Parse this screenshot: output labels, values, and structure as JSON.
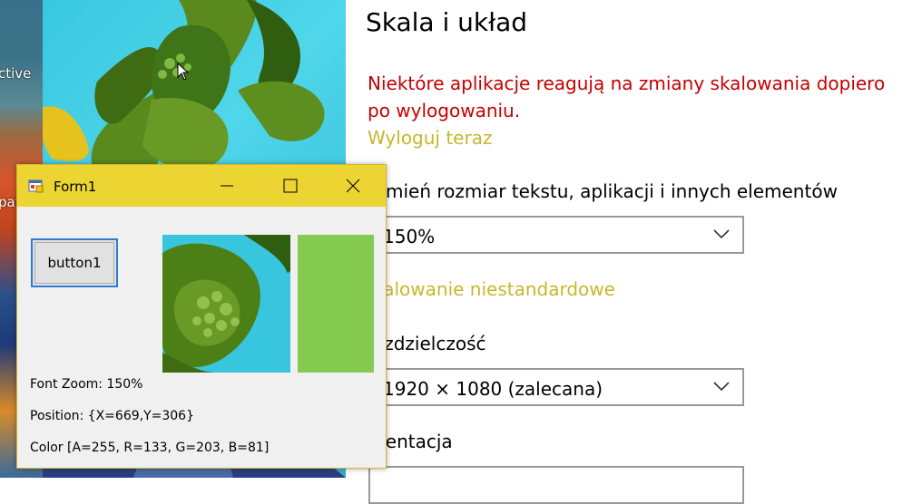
{
  "desktop": {
    "left_texts": [
      "ctive",
      "pat"
    ]
  },
  "settings": {
    "title": "Skala i układ",
    "warning": "Niektóre aplikacje reagują na zmiany skalowania dopiero po wylogowaniu.",
    "logout_link": "Wyloguj teraz",
    "size_label": "mień rozmiar tekstu, aplikacji i innych elementów",
    "scale_value": "150%",
    "custom_scaling_link": "kalowanie niestandardowe",
    "resolution_label": "ozdzielczość",
    "resolution_value": "1920 × 1080 (zalecana)",
    "orientation_label": "rientacja",
    "accent_link_color": "#c7b72c",
    "warning_color": "#c50000"
  },
  "form1": {
    "title": "Form1",
    "button_label": "button1",
    "font_zoom": "Font Zoom: 150%",
    "position": "Position: {X=669,Y=306}",
    "color": "Color [A=255, R=133, G=203, B=81]",
    "swatch_color": "#85cb51",
    "titlebar_color": "#ecd533"
  },
  "icons": [
    "app-icon",
    "minimize-icon",
    "maximize-icon",
    "close-icon",
    "chevron-down-icon",
    "mouse-cursor-icon"
  ]
}
